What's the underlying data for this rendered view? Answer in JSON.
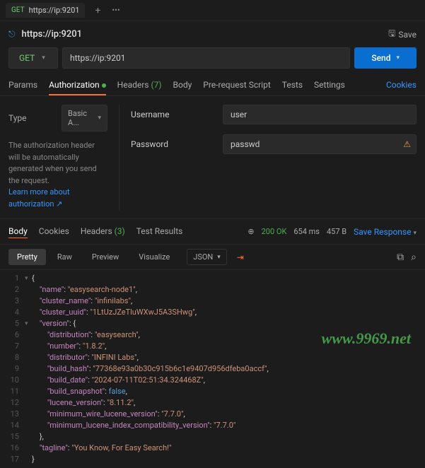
{
  "tab": {
    "method": "GET",
    "title": "https://ip:9201"
  },
  "request": {
    "title": "https://ip:9201",
    "save": "Save",
    "method": "GET",
    "url": "https://ip:9201",
    "send": "Send"
  },
  "reqTabs": {
    "params": "Params",
    "authorization": "Authorization",
    "headers": "Headers",
    "headersCount": "(7)",
    "body": "Body",
    "prerequest": "Pre-request Script",
    "tests": "Tests",
    "settings": "Settings",
    "cookies": "Cookies"
  },
  "auth": {
    "typeLabel": "Type",
    "typeValue": "Basic A...",
    "help1": "The authorization header will be automatically generated when you send the request.",
    "helpLink": "Learn more about authorization ↗",
    "usernameLabel": "Username",
    "usernameValue": "user",
    "passwordLabel": "Password",
    "passwordValue": "passwd"
  },
  "respTabs": {
    "body": "Body",
    "cookies": "Cookies",
    "headers": "Headers",
    "headersCount": "(3)",
    "testResults": "Test Results"
  },
  "status": {
    "code": "200 OK",
    "time": "654 ms",
    "size": "457 B",
    "saveResponse": "Save Response"
  },
  "viewer": {
    "pretty": "Pretty",
    "raw": "Raw",
    "preview": "Preview",
    "visualize": "Visualize",
    "format": "JSON"
  },
  "json": {
    "name": "easysearch-node1",
    "cluster_name": "infinilabs",
    "cluster_uuid": "1LtUzJZeTluWXwJ5A3SHwg",
    "version": {
      "distribution": "easysearch",
      "number": "1.8.2",
      "distributor": "INFINI Labs",
      "build_hash": "77368e93a0b30c915b6c1e9407d956dfeba0accf",
      "build_date": "2024-07-11T02:51:34.324468Z",
      "build_snapshot": "false",
      "lucene_version": "8.11.2",
      "minimum_wire_lucene_version": "7.7.0",
      "minimum_lucene_index_compatibility_version": "7.7.0"
    },
    "tagline": "You Know, For Easy Search!"
  },
  "watermark": "www.9969.net"
}
